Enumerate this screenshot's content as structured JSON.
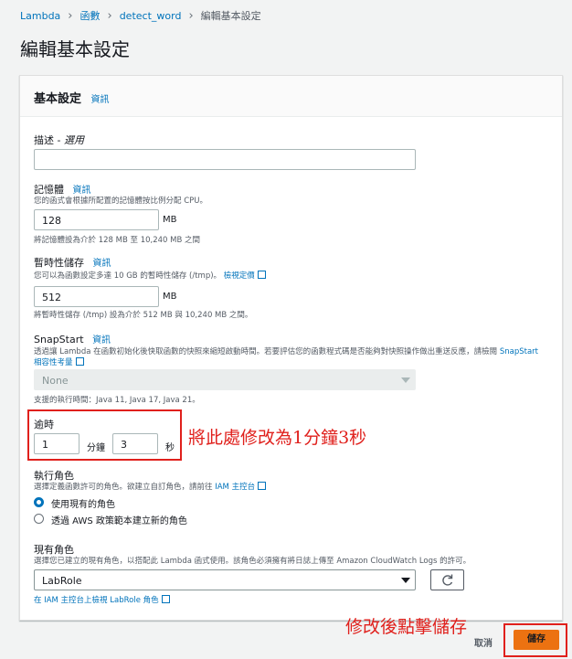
{
  "breadcrumb": {
    "items": [
      "Lambda",
      "函數",
      "detect_word"
    ],
    "current": "編輯基本設定"
  },
  "page_title": "編輯基本設定",
  "panel": {
    "title": "基本設定",
    "info_link": "資訊",
    "description": {
      "label": "描述 - ",
      "optional": "選用",
      "value": ""
    },
    "memory": {
      "label": "記憶體",
      "info": "資訊",
      "desc": "您的函式會根據所配置的記憶體按比例分配 CPU。",
      "value": "128",
      "unit": "MB",
      "hint": "將記憶體設為介於 128 MB 至 10,240 MB 之間"
    },
    "ephemeral": {
      "label": "暫時性儲存",
      "info": "資訊",
      "desc": "您可以為函數設定多達 10 GB 的暫時性儲存 (/tmp)。",
      "link": "檢視定價",
      "value": "512",
      "unit": "MB",
      "hint": "將暫時性儲存 (/tmp) 設為介於 512 MB 與 10,240 MB 之間。"
    },
    "snapstart": {
      "label": "SnapStart",
      "info": "資訊",
      "desc": "透過讓 Lambda 在函數初始化後快取函數的快照來縮短啟動時間。若要評估您的函數程式碼是否能夠對快照操作做出重送反應，請檢閱",
      "link": "SnapStart 相容性考量",
      "value": "None",
      "hint": "支援的執行時間：Java 11, Java 17, Java 21。"
    },
    "timeout": {
      "label": "逾時",
      "minutes": "1",
      "min_unit": "分鐘",
      "seconds": "3",
      "sec_unit": "秒"
    },
    "exec_role": {
      "label": "執行角色",
      "desc": "選擇定義函數許可的角色。欲建立自訂角色，請前往",
      "link": "IAM 主控台",
      "options": [
        "使用現有的角色",
        "透過 AWS 政策範本建立新的角色"
      ],
      "selected_index": 0
    },
    "existing_role": {
      "label": "現有角色",
      "desc": "選擇您已建立的現有角色，以搭配此 Lambda 函式使用。該角色必須擁有將日誌上傳至 Amazon CloudWatch Logs 的許可。",
      "value": "LabRole",
      "view_link": "在 IAM 主控台上檢視 LabRole 角色"
    }
  },
  "footer": {
    "cancel": "取消",
    "save": "儲存"
  },
  "annotations": {
    "timeout_note": "將此處修改為1分鐘3秒",
    "save_note": "修改後點擊儲存",
    "color": "#e0201c"
  },
  "colors": {
    "accent": "#0073bb",
    "primary_button": "#ec7211"
  }
}
